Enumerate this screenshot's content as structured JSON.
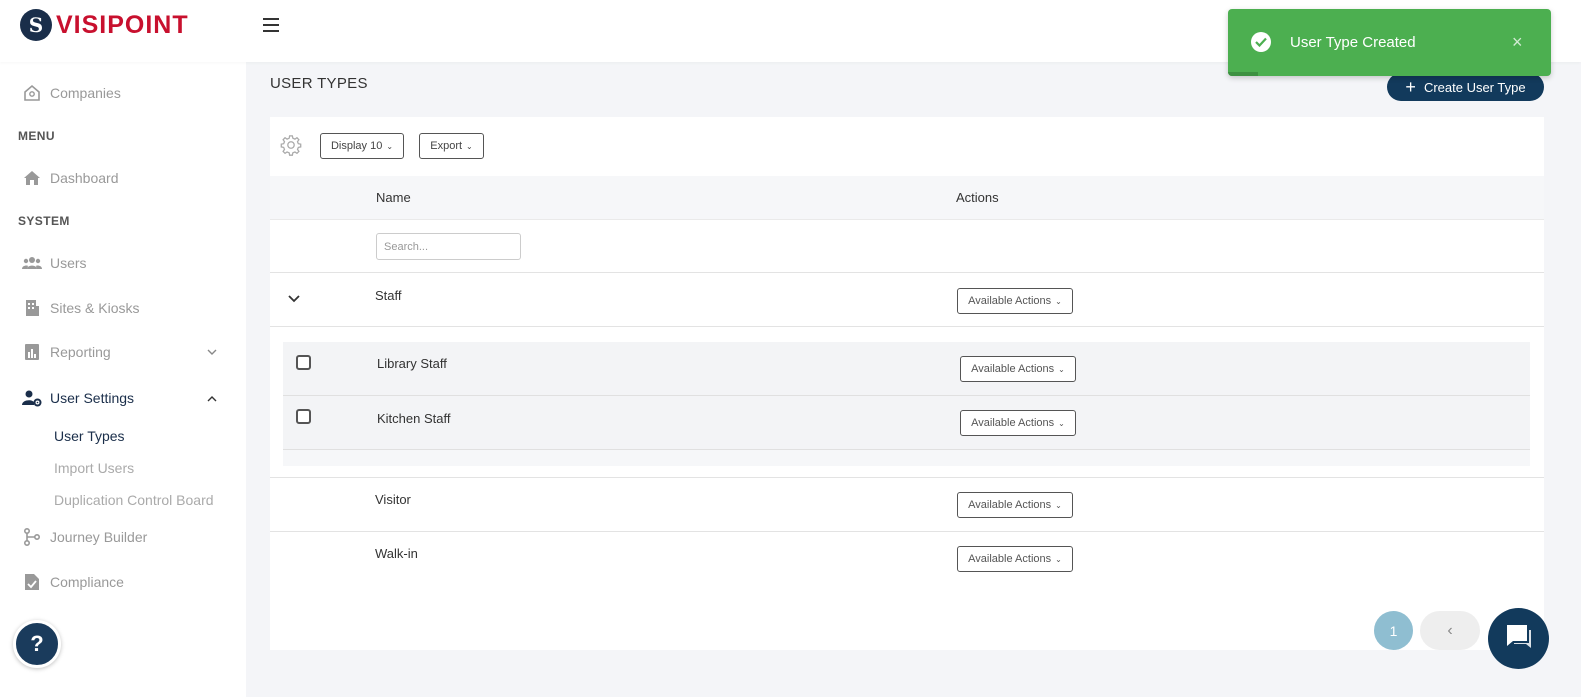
{
  "brand": {
    "logo_mark": "S",
    "name": "VISIPOINT",
    "accent": "#c8102e",
    "primary": "#123a5c"
  },
  "sidebar": {
    "top_item": {
      "label": "Companies",
      "icon": "building-outline-icon"
    },
    "sections": [
      {
        "heading": "MENU",
        "items": [
          {
            "label": "Dashboard",
            "icon": "home-icon"
          }
        ]
      },
      {
        "heading": "SYSTEM",
        "items": [
          {
            "label": "Users",
            "icon": "users-icon"
          },
          {
            "label": "Sites & Kiosks",
            "icon": "building-icon"
          },
          {
            "label": "Reporting",
            "icon": "report-icon",
            "expandable": true,
            "expanded": false
          },
          {
            "label": "User Settings",
            "icon": "user-gear-icon",
            "expandable": true,
            "expanded": true,
            "children": [
              "User Types",
              "Import Users",
              "Duplication Control Board"
            ]
          },
          {
            "label": "Journey Builder",
            "icon": "branch-icon"
          },
          {
            "label": "Compliance",
            "icon": "document-check-icon"
          }
        ]
      }
    ],
    "active_sub": "User Types"
  },
  "header": {
    "page_title": "USER TYPES",
    "create_button": "Create User Type"
  },
  "toolbar": {
    "display_label": "Display 10",
    "export_label": "Export"
  },
  "table": {
    "columns": [
      "Name",
      "Actions"
    ],
    "search_placeholder": "Search...",
    "actions_label": "Available Actions",
    "rows": [
      {
        "name": "Staff",
        "expanded": true,
        "children": [
          "Library Staff",
          "Kitchen Staff"
        ]
      },
      {
        "name": "Visitor"
      },
      {
        "name": "Walk-in"
      }
    ]
  },
  "pagination": {
    "current_page": "1",
    "prev_symbol": "‹"
  },
  "toast": {
    "message": "User Type Created",
    "close_symbol": "×",
    "color": "#4caf50"
  },
  "help": {
    "symbol": "?"
  }
}
